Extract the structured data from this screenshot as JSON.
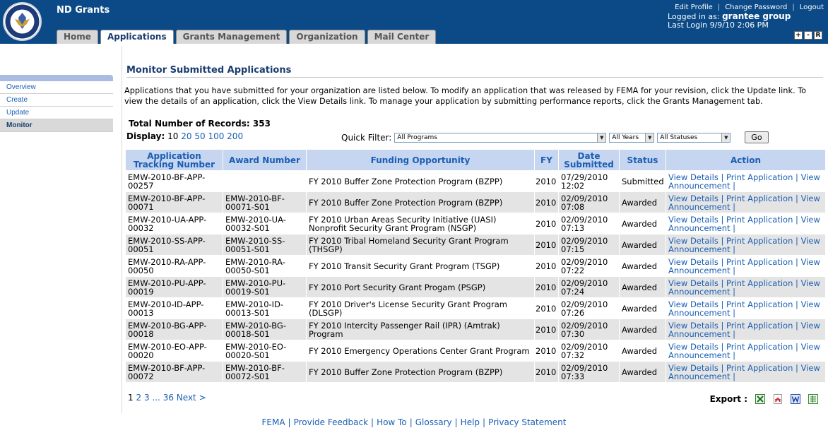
{
  "app": {
    "title": "ND Grants"
  },
  "tabs": [
    {
      "label": "Home"
    },
    {
      "label": "Applications"
    },
    {
      "label": "Grants Management"
    },
    {
      "label": "Organization"
    },
    {
      "label": "Mail Center"
    }
  ],
  "user": {
    "edit_profile": "Edit Profile",
    "change_password": "Change Password",
    "logout": "Logout",
    "logged_in_prefix": "Logged in as:",
    "logged_in_name": "grantee group",
    "last_login": "Last Login 9/9/10 2:06 PM",
    "font_buttons": [
      "+",
      "-",
      "R"
    ]
  },
  "sidebar": {
    "items": [
      {
        "label": "Overview"
      },
      {
        "label": "Create"
      },
      {
        "label": "Update"
      },
      {
        "label": "Monitor"
      }
    ]
  },
  "main": {
    "title": "Monitor Submitted Applications",
    "intro": "Applications that you have submitted for your organization are listed below. To modify an application that was released by FEMA for your revision, click the Update link. To view the details of an application, click the View Details link. To manage your application by submitting performance reports, click the Grants Management tab.",
    "total": "Total Number of Records: 353",
    "display_label": "Display:",
    "display_options": [
      "10",
      "20",
      "50",
      "100",
      "200"
    ],
    "quick_filter_label": "Quick Filter:",
    "filters": {
      "program": "All Programs",
      "year": "All Years",
      "status": "All Statuses"
    },
    "go_label": "Go"
  },
  "table": {
    "headers": [
      "Application Tracking Number",
      "Award Number",
      "Funding Opportunity",
      "FY",
      "Date Submitted",
      "Status",
      "Action"
    ],
    "rows": [
      {
        "tracking": "EMW-2010-BF-APP-00257",
        "award": "",
        "opportunity": "FY 2010 Buffer Zone Protection Program (BZPP)",
        "fy": "2010",
        "date": "07/29/2010 12:02",
        "status": "Submitted"
      },
      {
        "tracking": "EMW-2010-BF-APP-00071",
        "award": "EMW-2010-BF-00071-S01",
        "opportunity": "FY 2010 Buffer Zone Protection Program (BZPP)",
        "fy": "2010",
        "date": "02/09/2010 07:08",
        "status": "Awarded"
      },
      {
        "tracking": "EMW-2010-UA-APP-00032",
        "award": "EMW-2010-UA-00032-S01",
        "opportunity": "FY 2010 Urban Areas Security Initiative (UASI) Nonprofit Security Grant Program (NSGP)",
        "fy": "2010",
        "date": "02/09/2010 07:13",
        "status": "Awarded"
      },
      {
        "tracking": "EMW-2010-SS-APP-00051",
        "award": "EMW-2010-SS-00051-S01",
        "opportunity": "FY 2010 Tribal Homeland Security Grant Program (THSGP)",
        "fy": "2010",
        "date": "02/09/2010 07:15",
        "status": "Awarded"
      },
      {
        "tracking": "EMW-2010-RA-APP-00050",
        "award": "EMW-2010-RA-00050-S01",
        "opportunity": "FY 2010 Transit Security Grant Program (TSGP)",
        "fy": "2010",
        "date": "02/09/2010 07:22",
        "status": "Awarded"
      },
      {
        "tracking": "EMW-2010-PU-APP-00019",
        "award": "EMW-2010-PU-00019-S01",
        "opportunity": "FY 2010 Port Security Grant Progam (PSGP)",
        "fy": "2010",
        "date": "02/09/2010 07:24",
        "status": "Awarded"
      },
      {
        "tracking": "EMW-2010-ID-APP-00013",
        "award": "EMW-2010-ID-00013-S01",
        "opportunity": "FY 2010 Driver's License Security Grant Program (DLSGP)",
        "fy": "2010",
        "date": "02/09/2010 07:26",
        "status": "Awarded"
      },
      {
        "tracking": "EMW-2010-BG-APP-00018",
        "award": "EMW-2010-BG-00018-S01",
        "opportunity": "FY 2010 Intercity Passenger Rail (IPR) (Amtrak) Program",
        "fy": "2010",
        "date": "02/09/2010 07:30",
        "status": "Awarded"
      },
      {
        "tracking": "EMW-2010-EO-APP-00020",
        "award": "EMW-2010-EO-00020-S01",
        "opportunity": "FY 2010 Emergency Operations Center Grant Program",
        "fy": "2010",
        "date": "02/09/2010 07:32",
        "status": "Awarded"
      },
      {
        "tracking": "EMW-2010-BF-APP-00072",
        "award": "EMW-2010-BF-00072-S01",
        "opportunity": "FY 2010 Buffer Zone Protection Program (BZPP)",
        "fy": "2010",
        "date": "02/09/2010 07:33",
        "status": "Awarded"
      }
    ],
    "action": {
      "view_details": "View Details",
      "print": "Print Application",
      "view": "View",
      "announcement": "Announcement"
    }
  },
  "pager": {
    "current": "1",
    "pages": [
      "2",
      "3"
    ],
    "ellipsis": "...",
    "last": "36",
    "next": "Next >"
  },
  "export": {
    "label": "Export :",
    "icons": [
      "excel-icon",
      "pdf-icon",
      "word-icon",
      "csv-icon"
    ]
  },
  "footer": {
    "links": [
      "FEMA",
      "Provide Feedback",
      "How To",
      "Glossary",
      "Help",
      "Privacy Statement"
    ]
  },
  "colors": {
    "header": "#0b4a87",
    "link": "#1a5fb4",
    "table_header": "#c6d5f0",
    "row_alt": "#e4e4e4",
    "sidebar_accent": "#a9bde2"
  }
}
